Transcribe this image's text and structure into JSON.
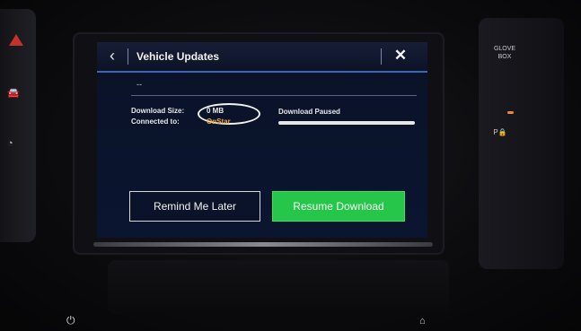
{
  "header": {
    "back_glyph": "‹",
    "title": "Vehicle Updates",
    "close_glyph": "✕"
  },
  "subtitle": "--",
  "info": {
    "download_size_label": "Download Size:",
    "download_size_value": "0 MB",
    "connected_to_label": "Connected to:",
    "connected_to_value": "OnStar"
  },
  "status": {
    "text": "Download Paused",
    "progress": 1.0
  },
  "buttons": {
    "remind_me_later": "Remind Me Later",
    "resume_download": "Resume Download"
  },
  "physical_controls": {
    "glove_box_label": "GLOVE BOX",
    "p_lock_label": "P🔒"
  },
  "colors": {
    "accent": "#3e64b8",
    "connected_value": "#f0a63a",
    "resume_button": "#26c64a"
  },
  "icons": {
    "back": "chevron-left-icon",
    "close": "close-icon",
    "power": "power-icon",
    "home": "home-icon",
    "hazard": "hazard-triangle-icon"
  }
}
